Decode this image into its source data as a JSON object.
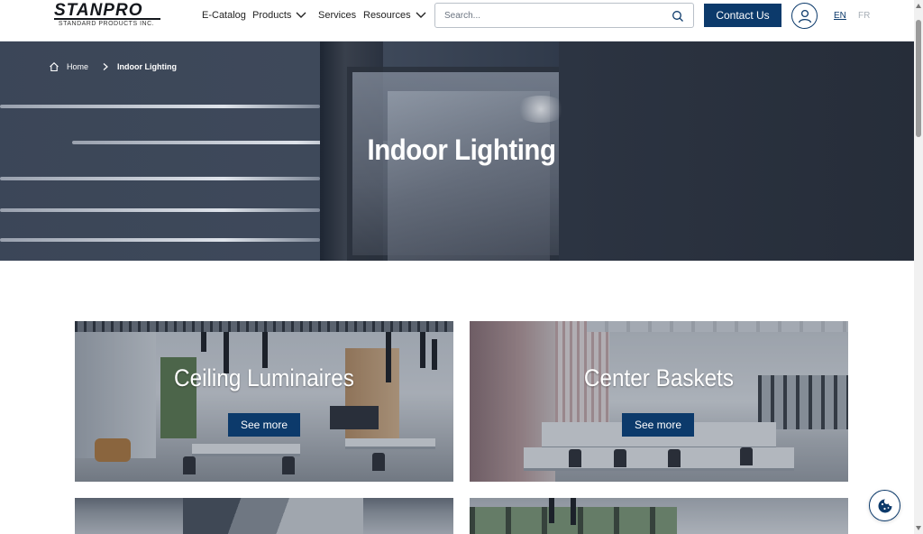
{
  "header": {
    "logo": {
      "name": "STANPRO",
      "tagline": "STANDARD PRODUCTS INC."
    },
    "nav": [
      {
        "label": "E-Catalog",
        "dropdown": false
      },
      {
        "label": "Products",
        "dropdown": true
      },
      {
        "label": "Services",
        "dropdown": false
      },
      {
        "label": "Resources",
        "dropdown": true
      }
    ],
    "search": {
      "placeholder": "Search...",
      "value": ""
    },
    "contact_label": "Contact Us",
    "languages": [
      {
        "code": "EN",
        "active": true
      },
      {
        "code": "FR",
        "active": false
      }
    ]
  },
  "hero": {
    "breadcrumb": {
      "home": "Home",
      "current": "Indoor Lighting"
    },
    "title": "Indoor Lighting"
  },
  "cards": [
    {
      "title": "Ceiling Luminaires",
      "button": "See more"
    },
    {
      "title": "Center Baskets",
      "button": "See more"
    }
  ],
  "icons": {
    "home": "home-icon",
    "breadcrumb_separator": "chevron-right-icon",
    "search": "search-icon",
    "account": "user-icon",
    "cookie": "cookie-icon",
    "dropdown": "chevron-down-icon"
  },
  "colors": {
    "brand": "#0c3a6b",
    "text": "#222222",
    "inactive_lang": "#a8afb7"
  }
}
